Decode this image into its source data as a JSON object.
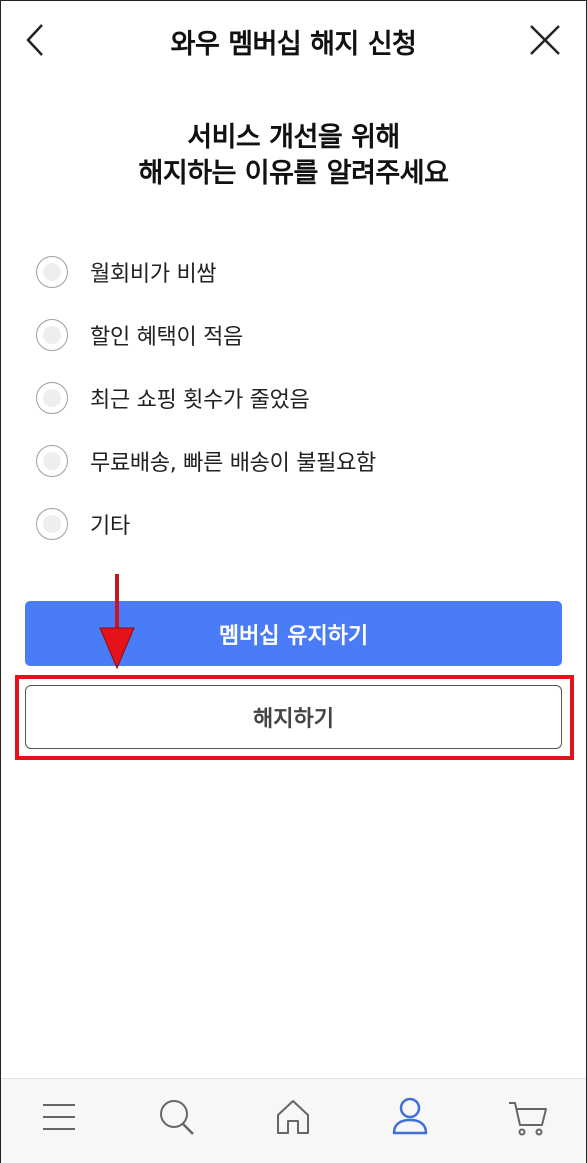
{
  "header": {
    "title": "와우 멤버십 해지 신청",
    "back_icon": "chevron-left-icon",
    "close_icon": "close-icon"
  },
  "headline": {
    "line1": "서비스 개선을 위해",
    "line2": "해지하는 이유를 알려주세요"
  },
  "reasons": [
    {
      "label": "월회비가 비쌈"
    },
    {
      "label": "할인 혜택이 적음"
    },
    {
      "label": "최근 쇼핑 횟수가 줄었음"
    },
    {
      "label": "무료배송, 빠른 배송이 불필요함"
    },
    {
      "label": "기타"
    }
  ],
  "actions": {
    "keep_label": "멤버십 유지하기",
    "cancel_label": "해지하기"
  },
  "bottom_nav": [
    {
      "icon": "menu-icon"
    },
    {
      "icon": "search-icon"
    },
    {
      "icon": "home-icon"
    },
    {
      "icon": "profile-icon",
      "active": true
    },
    {
      "icon": "cart-icon"
    }
  ],
  "colors": {
    "accent": "#4a7cf7",
    "highlight": "#e4121a",
    "nav_active": "#3f6fd8",
    "nav_inactive": "#666666"
  }
}
